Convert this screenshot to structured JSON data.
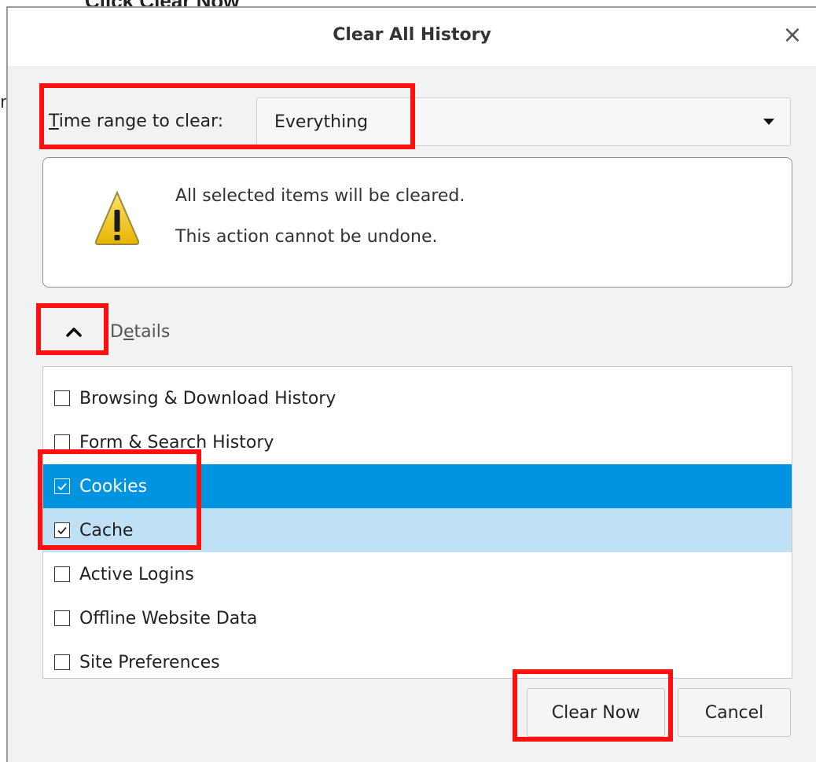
{
  "caption": {
    "text": "Click Clear Now"
  },
  "left_fragment": "n",
  "dialog": {
    "title": "Clear All History",
    "close_glyph": "×",
    "time_range": {
      "label_accel": "T",
      "label_rest": "ime range to clear:",
      "value": "Everything"
    },
    "warning": {
      "line1": "All selected items will be cleared.",
      "line2": "This action cannot be undone."
    },
    "details": {
      "label_pre": "D",
      "label_accel": "e",
      "label_post": "tails",
      "expanded": true
    },
    "items": [
      {
        "label": "Browsing & Download History",
        "checked": false
      },
      {
        "label": "Form & Search History",
        "checked": false
      },
      {
        "label": "Cookies",
        "checked": true
      },
      {
        "label": "Cache",
        "checked": true
      },
      {
        "label": "Active Logins",
        "checked": false
      },
      {
        "label": "Offline Website Data",
        "checked": false
      },
      {
        "label": "Site Preferences",
        "checked": false
      }
    ],
    "buttons": {
      "clear_now": "Clear Now",
      "cancel": "Cancel"
    }
  },
  "colors": {
    "highlight": "#ff1010",
    "selected_row": "#0094e0",
    "hover_row": "#bfe0f5",
    "warning_yellow": "#f2c811"
  },
  "icons": {
    "warning": "warning-triangle-icon",
    "close": "close-icon",
    "dropdown": "dropdown-arrow-icon",
    "collapse": "chevron-up-icon"
  }
}
